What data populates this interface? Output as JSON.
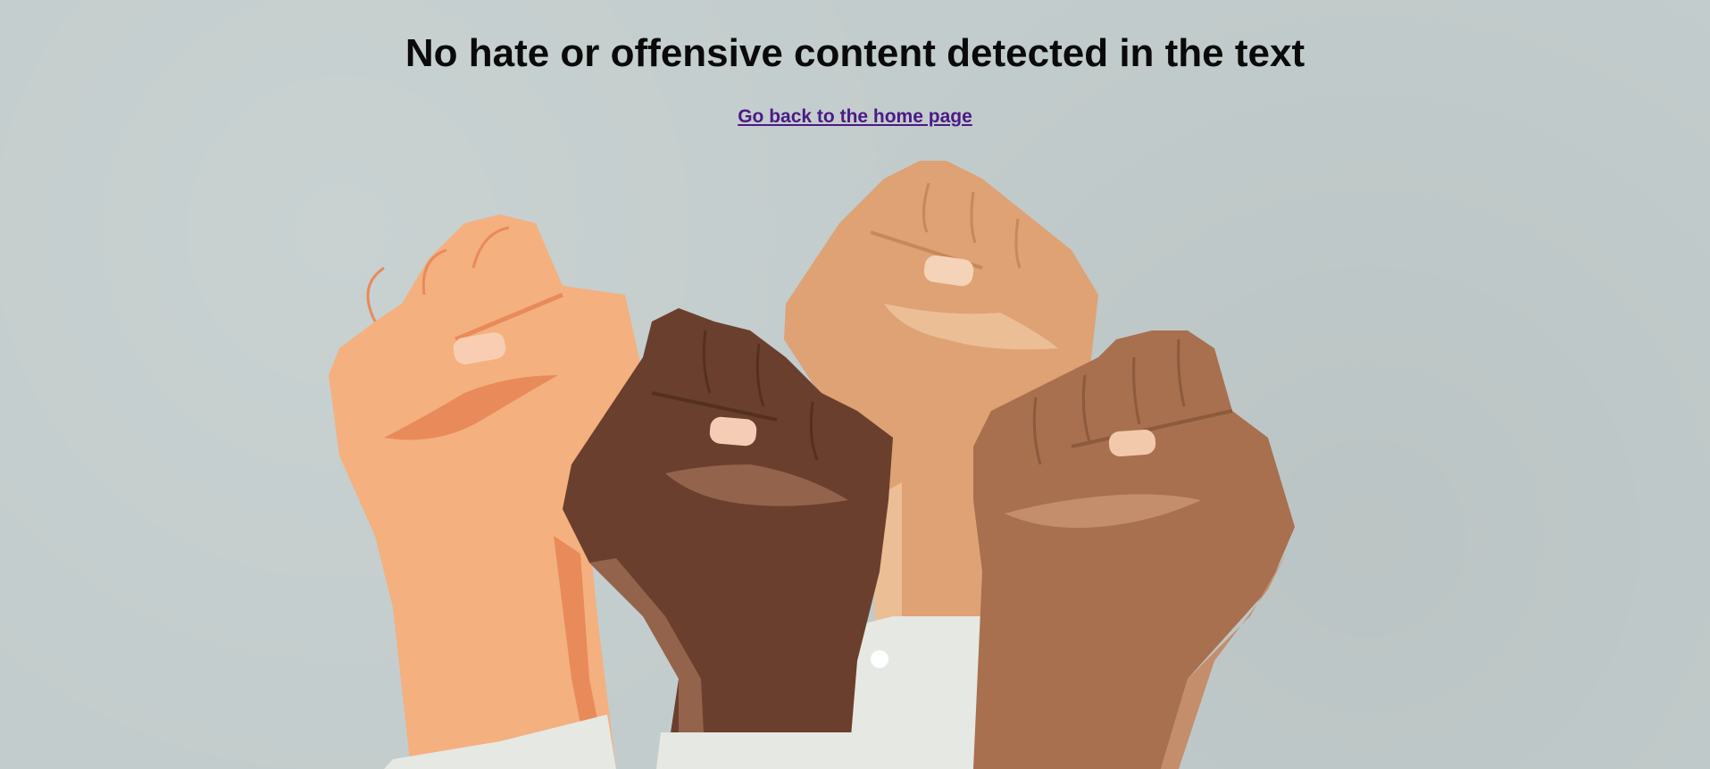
{
  "page": {
    "heading": "No hate or offensive content detected in the text",
    "home_link": "Go back to the home page"
  },
  "colors": {
    "background": "#c3cccc",
    "heading": "#0a0a0a",
    "link": "#4b1a86",
    "fist_light": "#f4b07f",
    "fist_tan": "#dea275",
    "fist_dark": "#6b3f2e",
    "fist_medium": "#a8704f",
    "sleeve": "#e6e8e3"
  },
  "illustration": {
    "icon": "raised-fists-illustration"
  }
}
